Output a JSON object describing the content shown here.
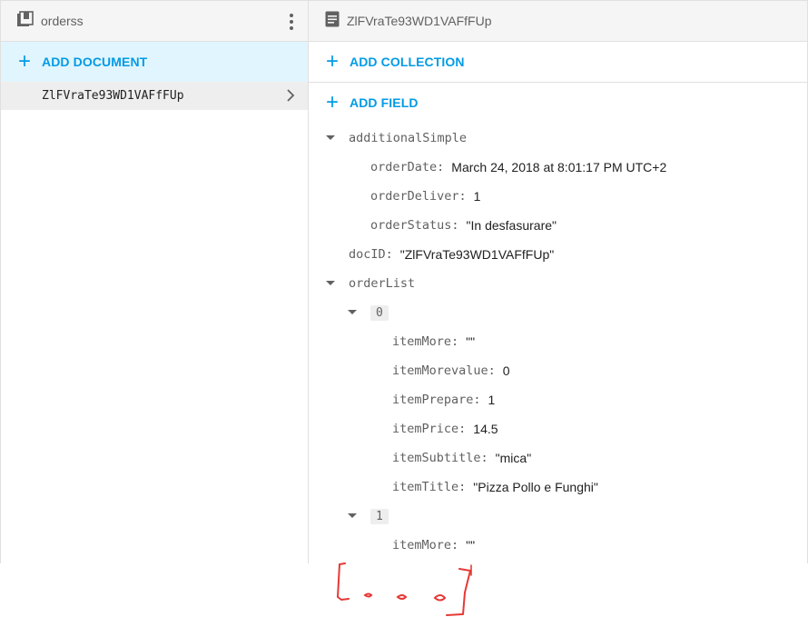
{
  "left_panel": {
    "collection_name": "orderss",
    "collection_icon": "collection-icon",
    "menu_icon": "more-vert-icon",
    "add_document_label": "ADD DOCUMENT",
    "documents": [
      {
        "id": "ZlFVraTe93WD1VAFfFUp",
        "selected": true
      }
    ]
  },
  "right_panel": {
    "document_name": "ZlFVraTe93WD1VAFfFUp",
    "document_icon": "document-icon",
    "add_collection_label": "ADD COLLECTION",
    "add_field_label": "ADD FIELD",
    "fields": {
      "additionalSimple": {
        "key": "additionalSimple",
        "orderDate": {
          "key": "orderDate:",
          "value": "March 24, 2018 at 8:01:17 PM UTC+2"
        },
        "orderDeliver": {
          "key": "orderDeliver:",
          "value": "1"
        },
        "orderStatus": {
          "key": "orderStatus:",
          "value": "\"In desfasurare\""
        }
      },
      "docID": {
        "key": "docID:",
        "value": "\"ZlFVraTe93WD1VAFfFUp\""
      },
      "orderList": {
        "key": "orderList",
        "item0": {
          "index": "0",
          "itemMore": {
            "key": "itemMore:",
            "value": "\"\""
          },
          "itemMorevalue": {
            "key": "itemMorevalue:",
            "value": "0"
          },
          "itemPrepare": {
            "key": "itemPrepare:",
            "value": "1"
          },
          "itemPrice": {
            "key": "itemPrice:",
            "value": "14.5"
          },
          "itemSubtitle": {
            "key": "itemSubtitle:",
            "value": "\"mica\""
          },
          "itemTitle": {
            "key": "itemTitle:",
            "value": "\"Pizza Pollo e Funghi\""
          }
        },
        "item1": {
          "index": "1",
          "itemMore": {
            "key": "itemMore:",
            "value": "\"\""
          }
        }
      }
    }
  },
  "colors": {
    "accent": "#039be5",
    "selected_bg": "#e1f5fe",
    "annotation": "#e53935"
  }
}
